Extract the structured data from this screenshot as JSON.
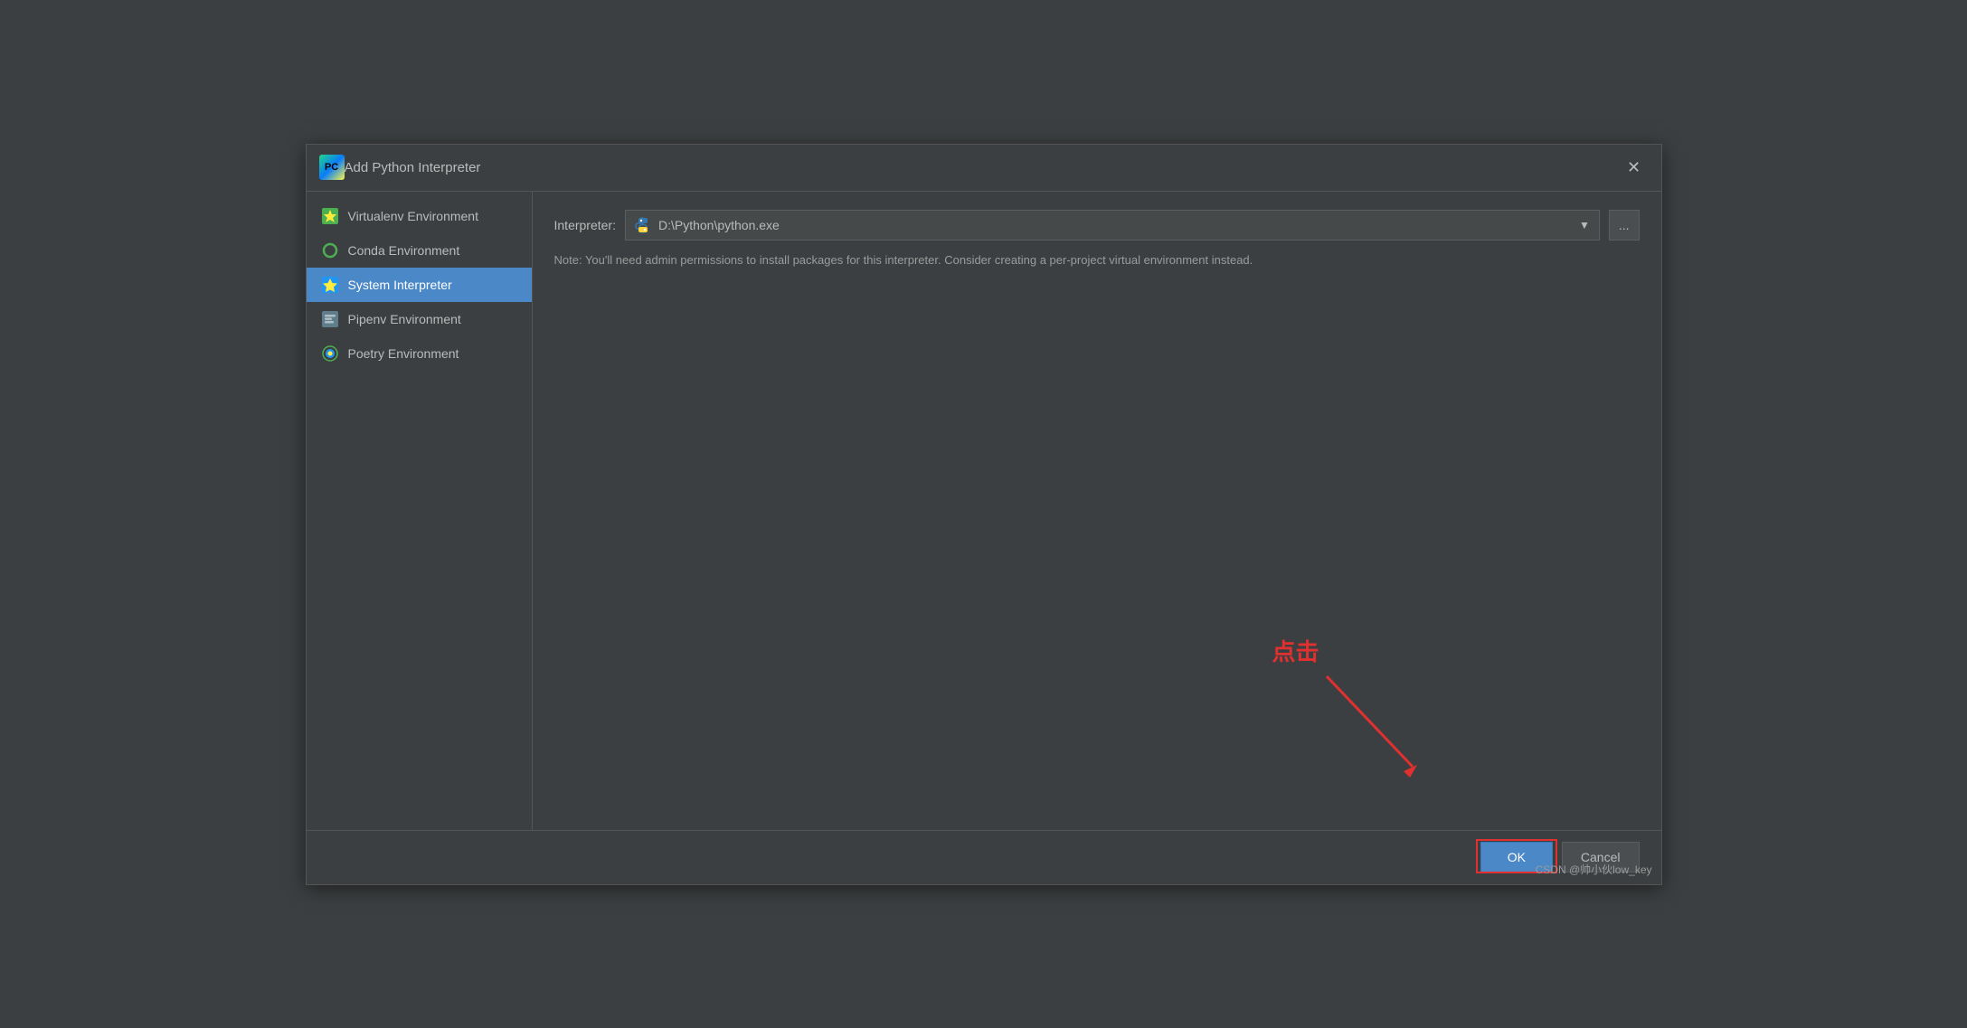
{
  "dialog": {
    "title": "Add Python Interpreter",
    "close_label": "✕"
  },
  "sidebar": {
    "items": [
      {
        "id": "virtualenv",
        "label": "Virtualenv Environment",
        "icon_type": "virtualenv",
        "active": false
      },
      {
        "id": "conda",
        "label": "Conda Environment",
        "icon_type": "conda",
        "active": false
      },
      {
        "id": "system",
        "label": "System Interpreter",
        "icon_type": "system",
        "active": true
      },
      {
        "id": "pipenv",
        "label": "Pipenv Environment",
        "icon_type": "pipenv",
        "active": false
      },
      {
        "id": "poetry",
        "label": "Poetry Environment",
        "icon_type": "poetry",
        "active": false
      }
    ]
  },
  "main": {
    "interpreter_label": "Interpreter:",
    "interpreter_value": "D:\\Python\\python.exe",
    "browse_label": "...",
    "note": "Note: You'll need admin permissions to install packages for this interpreter. Consider creating a per-project virtual environment instead."
  },
  "footer": {
    "ok_label": "OK",
    "cancel_label": "Cancel"
  },
  "annotation": {
    "text": "点击",
    "watermark": "CSDN @帅小伙low_key"
  }
}
